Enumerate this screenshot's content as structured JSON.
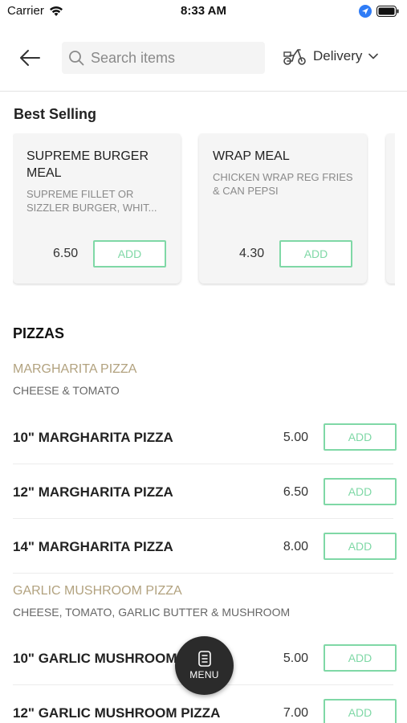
{
  "status_bar": {
    "carrier": "Carrier",
    "time": "8:33 AM"
  },
  "header": {
    "search_placeholder": "Search items",
    "delivery_label": "Delivery"
  },
  "best_selling": {
    "title": "Best Selling",
    "items": [
      {
        "name": "SUPREME BURGER MEAL",
        "description": "SUPREME FILLET OR SIZZLER BURGER, WHIT...",
        "price": "6.50",
        "add_label": "ADD"
      },
      {
        "name": "WRAP MEAL",
        "description": "CHICKEN WRAP REG FRIES & CAN PEPSI",
        "price": "4.30",
        "add_label": "ADD"
      }
    ]
  },
  "menu": {
    "category": "PIZZAS",
    "groups": [
      {
        "name": "MARGHARITA PIZZA",
        "description": "CHEESE & TOMATO",
        "items": [
          {
            "name": "10\" MARGHARITA PIZZA",
            "price": "5.00",
            "add_label": "ADD"
          },
          {
            "name": "12\" MARGHARITA PIZZA",
            "price": "6.50",
            "add_label": "ADD"
          },
          {
            "name": "14\" MARGHARITA PIZZA",
            "price": "8.00",
            "add_label": "ADD"
          }
        ]
      },
      {
        "name": "GARLIC MUSHROOM PIZZA",
        "description": "CHEESE, TOMATO, GARLIC BUTTER & MUSHROOM",
        "items": [
          {
            "name": "10\" GARLIC MUSHROOM PIZZA",
            "price": "5.00",
            "add_label": "ADD"
          },
          {
            "name": "12\" GARLIC MUSHROOM PIZZA",
            "price": "7.00",
            "add_label": "ADD"
          }
        ]
      }
    ]
  },
  "fab": {
    "label": "MENU",
    "icon": "menu-list-icon"
  },
  "colors": {
    "accent_green": "#7fd8a6",
    "group_gold": "#b2a27f",
    "fab_bg": "#2b2b2b"
  }
}
